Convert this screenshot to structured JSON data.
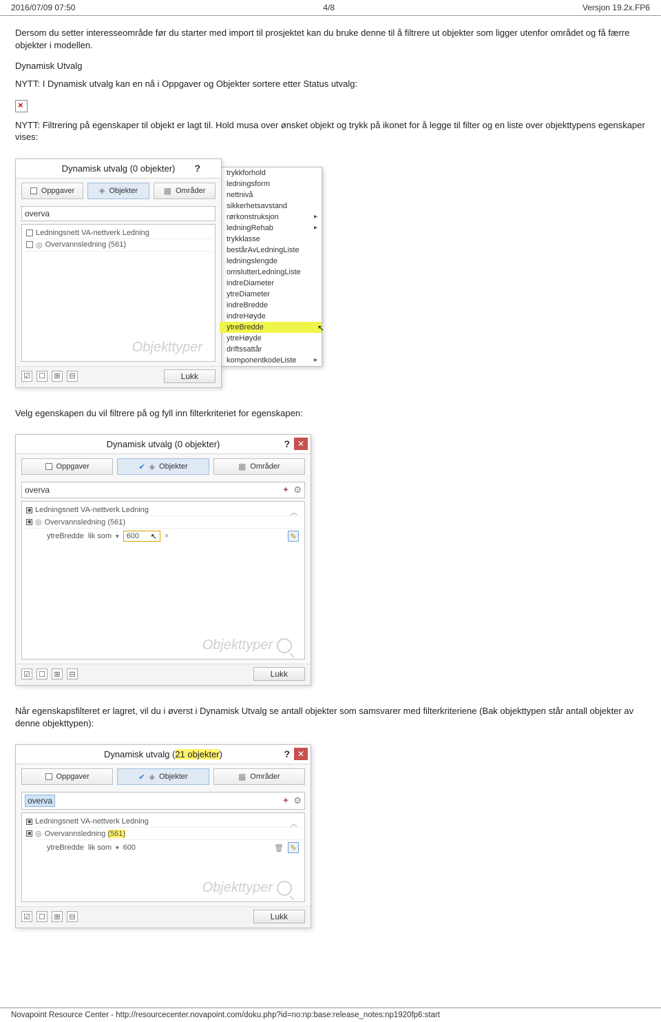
{
  "header": {
    "datetime": "2016/07/09 07:50",
    "page": "4/8",
    "version": "Versjon 19.2x.FP6"
  },
  "para1": "Dersom du setter interesseområde før du starter med import til prosjektet kan du bruke denne til å filtrere ut objekter som ligger utenfor området og få færre objekter i modellen.",
  "section_dyn": "Dynamisk Utvalg",
  "para2": "NYTT: I Dynamisk utvalg kan en nå i Oppgaver og Objekter sortere etter Status utvalg:",
  "para3": "NYTT: Filtrering på egenskaper til objekt er lagt til. Hold musa over ønsket objekt og trykk på ikonet for å legge til filter og en liste over objekttypens egenskaper vises:",
  "common": {
    "tab_tasks": "Oppgaver",
    "tab_objects": "Objekter",
    "tab_areas": "Områder",
    "search": "overva",
    "watermark": "Objekttyper",
    "close_btn": "Lukk",
    "help": "?",
    "row_ledning": "Ledningsnett VA-nettverk Ledning",
    "row_overvann": "Overvannsledning (561)"
  },
  "sshot1": {
    "title": "Dynamisk utvalg (0 objekter)",
    "menu": [
      {
        "t": "trykkforhold"
      },
      {
        "t": "ledningsform"
      },
      {
        "t": "nettnivå"
      },
      {
        "t": "sikkerhetsavstand"
      },
      {
        "t": "rørkonstruksjon",
        "sub": true
      },
      {
        "t": "ledningRehab",
        "sub": true
      },
      {
        "t": "trykklasse"
      },
      {
        "t": "bestårAvLedningListe"
      },
      {
        "t": "ledningslengde"
      },
      {
        "t": "omslutterLedningListe"
      },
      {
        "t": "indreDiameter"
      },
      {
        "t": "ytreDiameter"
      },
      {
        "t": "indreBredde"
      },
      {
        "t": "indreHøyde"
      },
      {
        "t": "ytreBredde",
        "sel": true
      },
      {
        "t": "ytreHøyde"
      },
      {
        "t": "driftssattår"
      },
      {
        "t": "komponentkodeListe",
        "sub": true
      }
    ]
  },
  "para4": "Velg egenskapen du vil filtrere på og fyll inn filterkriteriet for egenskapen:",
  "sshot2": {
    "title": "Dynamisk utvalg (0 objekter)",
    "filter_prop": "ytreBredde",
    "filter_op": "lik som",
    "filter_val": "600"
  },
  "para5": "Når egenskapsfilteret er lagret, vil du i øverst i Dynamisk Utvalg se antall objekter som samsvarer med filterkriteriene (Bak objekttypen står antall objekter av denne objekttypen):",
  "sshot3": {
    "title_pre": "Dynamisk utvalg (",
    "title_hl": "21 objekter",
    "title_post": ")",
    "row_overvann_pre": "Overvannsledning ",
    "row_overvann_hl": "(561)",
    "filter_prop": "ytreBredde",
    "filter_op": "lik som",
    "filter_val": "600"
  },
  "footer": "Novapoint Resource Center - http://resourcecenter.novapoint.com/doku.php?id=no:np:base:release_notes:np1920fp6:start"
}
